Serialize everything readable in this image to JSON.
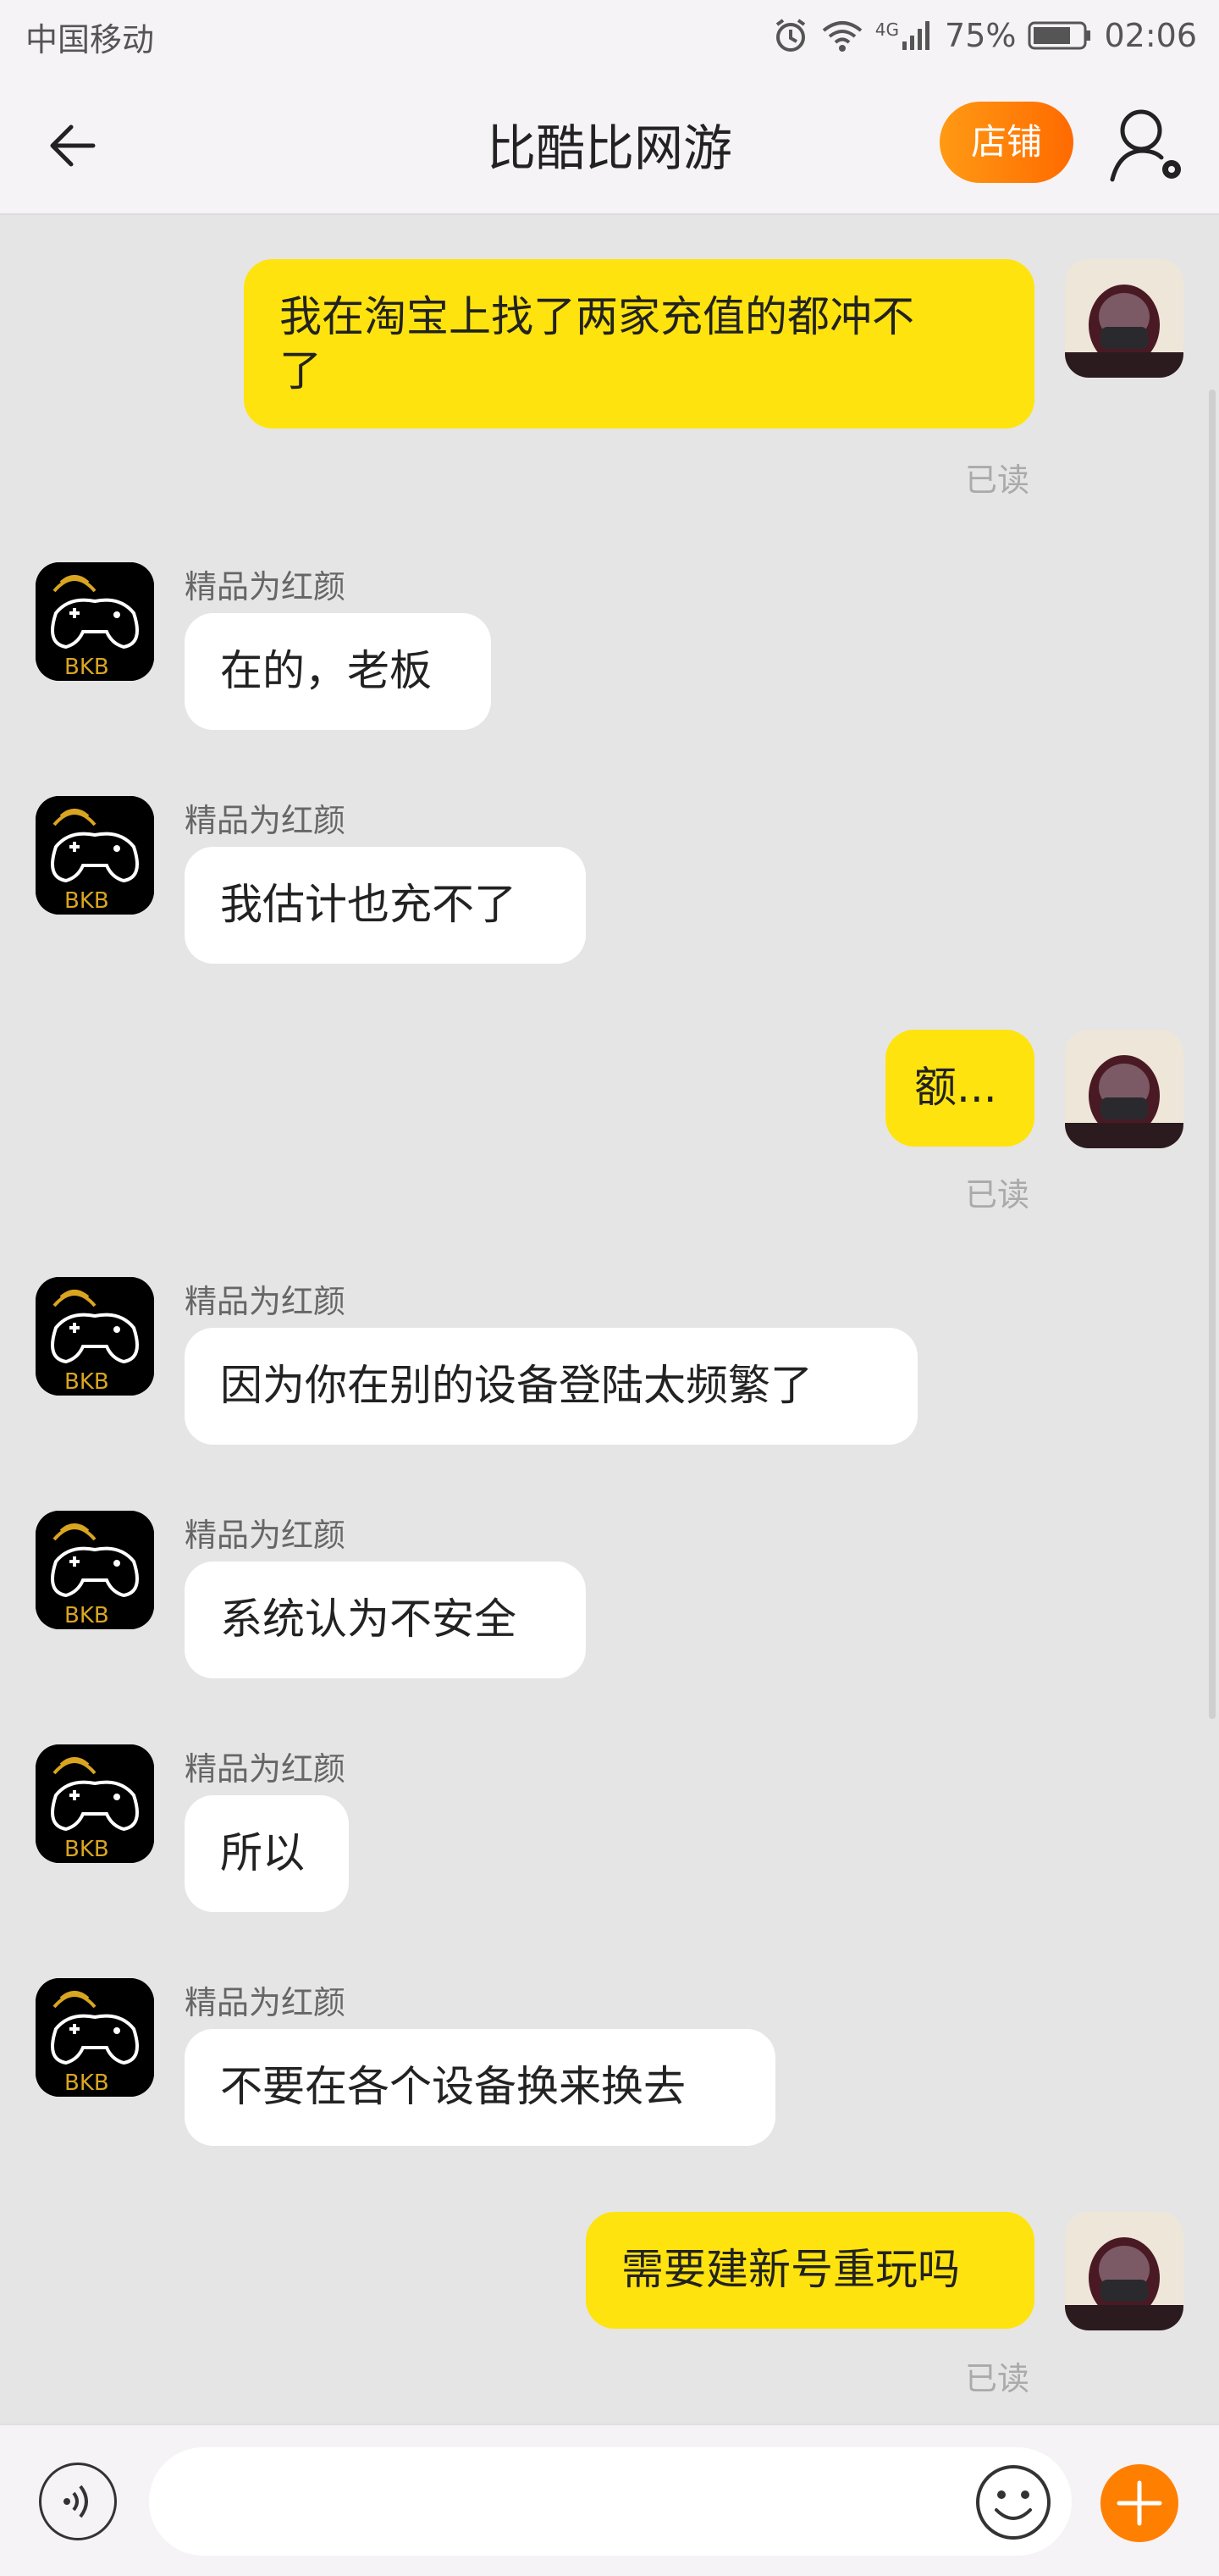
{
  "status_bar": {
    "carrier": "中国移动",
    "network": "4G",
    "battery": "75%",
    "time": "02:06"
  },
  "header": {
    "title": "比酷比网游",
    "store_label": "店铺"
  },
  "messages": [
    {
      "side": "out",
      "lines": [
        "我在淘宝上找了两家充值的都冲不",
        "了"
      ],
      "read": "已读"
    },
    {
      "side": "in",
      "sender": "精品为红颜",
      "text": "在的，老板"
    },
    {
      "side": "in",
      "sender": "精品为红颜",
      "text": "我估计也充不了"
    },
    {
      "side": "out",
      "lines": [
        "额..."
      ],
      "read": "已读"
    },
    {
      "side": "in",
      "sender": "精品为红颜",
      "text": "因为你在别的设备登陆太频繁了"
    },
    {
      "side": "in",
      "sender": "精品为红颜",
      "text": "系统认为不安全"
    },
    {
      "side": "in",
      "sender": "精品为红颜",
      "text": "所以"
    },
    {
      "side": "in",
      "sender": "精品为红颜",
      "text": "不要在各个设备换来换去"
    },
    {
      "side": "out",
      "lines": [
        "需要建新号重玩吗"
      ],
      "read": "已读"
    }
  ],
  "shop_avatar_text": "BKB",
  "shop_avatar_sub": "Game",
  "input": {
    "placeholder": ""
  },
  "colors": {
    "outgoing_bubble": "#ffe30e",
    "incoming_bubble": "#ffffff",
    "accent": "#ff7f00",
    "background": "#e5e5e5"
  }
}
